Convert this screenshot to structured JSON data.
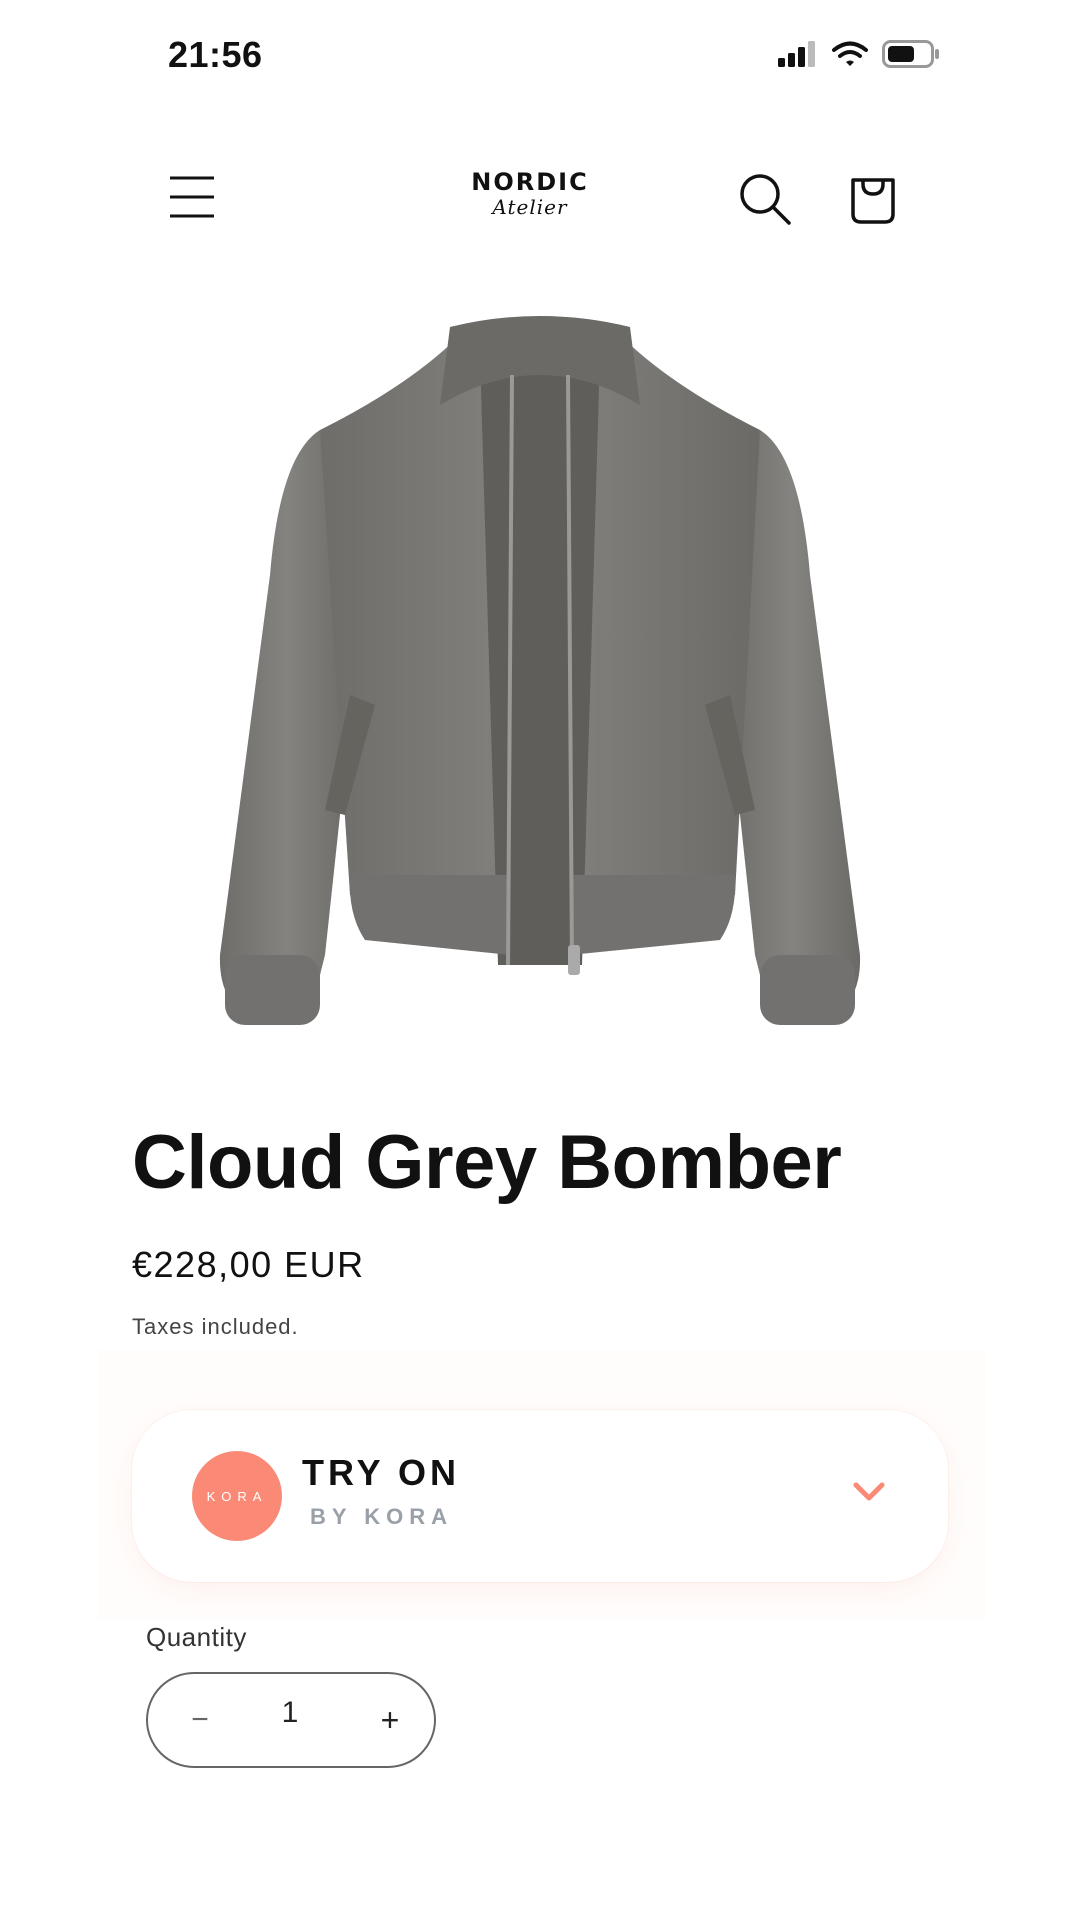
{
  "status_bar": {
    "time": "21:56",
    "icons": [
      "cellular-signal-icon",
      "wifi-icon",
      "battery-icon"
    ]
  },
  "header": {
    "menu_icon": "hamburger-menu-icon",
    "brand_name": "NORDIC",
    "brand_sub": "Atelier",
    "search_icon": "search-icon",
    "cart_icon": "shopping-bag-icon"
  },
  "product": {
    "image": "grey-bomber-jacket-image",
    "title": "Cloud Grey Bomber",
    "price": "€228,00 EUR",
    "tax_note": "Taxes included."
  },
  "try_on": {
    "badge": "KORA",
    "title": "TRY ON",
    "subtitle": "BY KORA",
    "accent_color": "#fa8a75",
    "chevron_icon": "chevron-down-icon"
  },
  "quantity": {
    "label": "Quantity",
    "value": "1",
    "minus": "−",
    "plus": "+"
  }
}
